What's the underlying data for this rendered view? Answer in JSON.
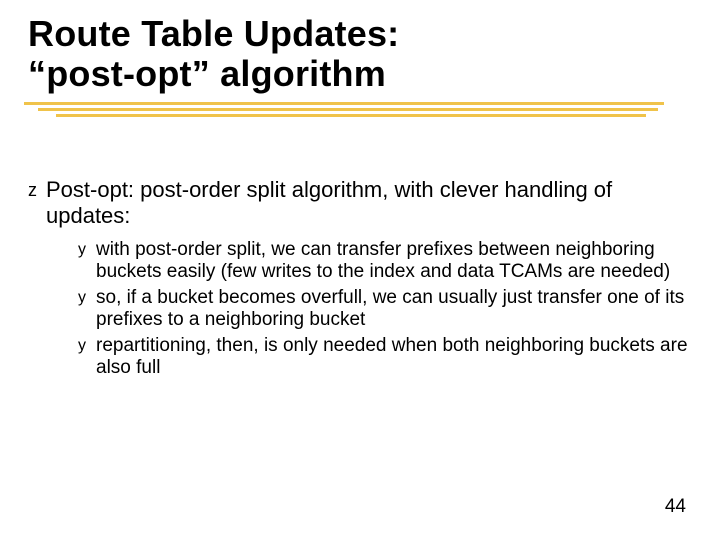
{
  "title_line1": "Route Table Updates:",
  "title_line2": "“post-opt” algorithm",
  "bullets": {
    "lvl1_bullet_char": "z",
    "lvl2_bullet_char": "y",
    "item1": "Post-opt: post-order split algorithm, with clever handling of updates:",
    "sub1": "with post-order split, we can transfer prefixes between neighboring buckets easily (few writes to the index and data TCAMs are needed)",
    "sub2": "so, if a bucket becomes overfull, we can usually just transfer one of its prefixes to a neighboring bucket",
    "sub3": "repartitioning, then, is only needed when both neighboring buckets are also full"
  },
  "page_number": "44"
}
